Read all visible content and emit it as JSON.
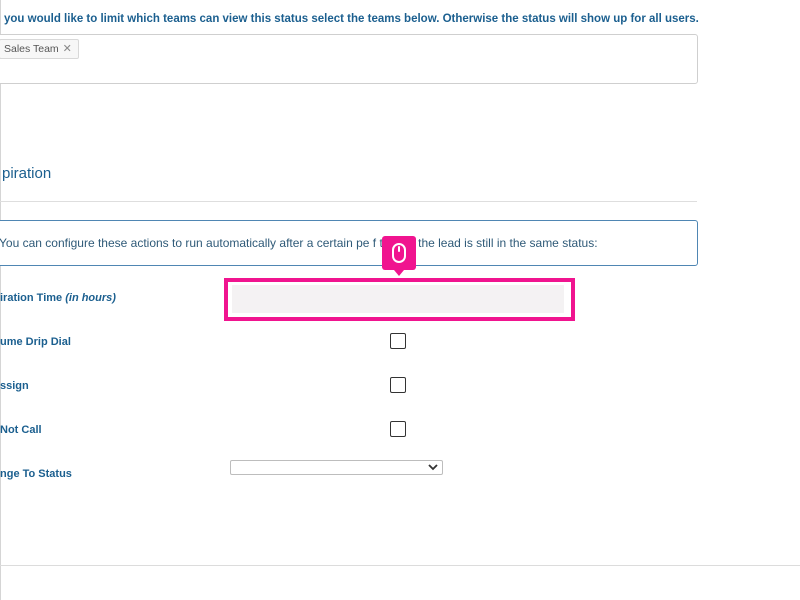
{
  "teams_section": {
    "intro_text": "you would like to limit which teams can view this status select the teams below. Otherwise the status will show up for all users.",
    "selected_teams": [
      {
        "label": "Sales Team",
        "remove_glyph": "✕"
      }
    ]
  },
  "expiration_section": {
    "heading": "piration",
    "info_text": "You can configure these actions to run automatically after a certain pe    f time, if the lead is still in the same status:"
  },
  "fields": {
    "expiration_time": {
      "label": "iration Time",
      "label_suffix": "(in hours)",
      "value": ""
    },
    "resume_drip_dial": {
      "label": "ume Drip Dial",
      "checked": false
    },
    "reassign": {
      "label": "ssign",
      "checked": false
    },
    "do_not_call": {
      "label": "Not Call",
      "checked": false
    },
    "change_to_status": {
      "label": "nge To Status",
      "selected": ""
    }
  },
  "colors": {
    "label_blue": "#1b5f8f",
    "highlight_pink": "#f0148f",
    "info_border": "#4f86b3"
  },
  "icons": {
    "cursor_badge": "mouse-icon",
    "tag_remove": "close-icon",
    "select_arrow": "chevron-down-icon"
  }
}
